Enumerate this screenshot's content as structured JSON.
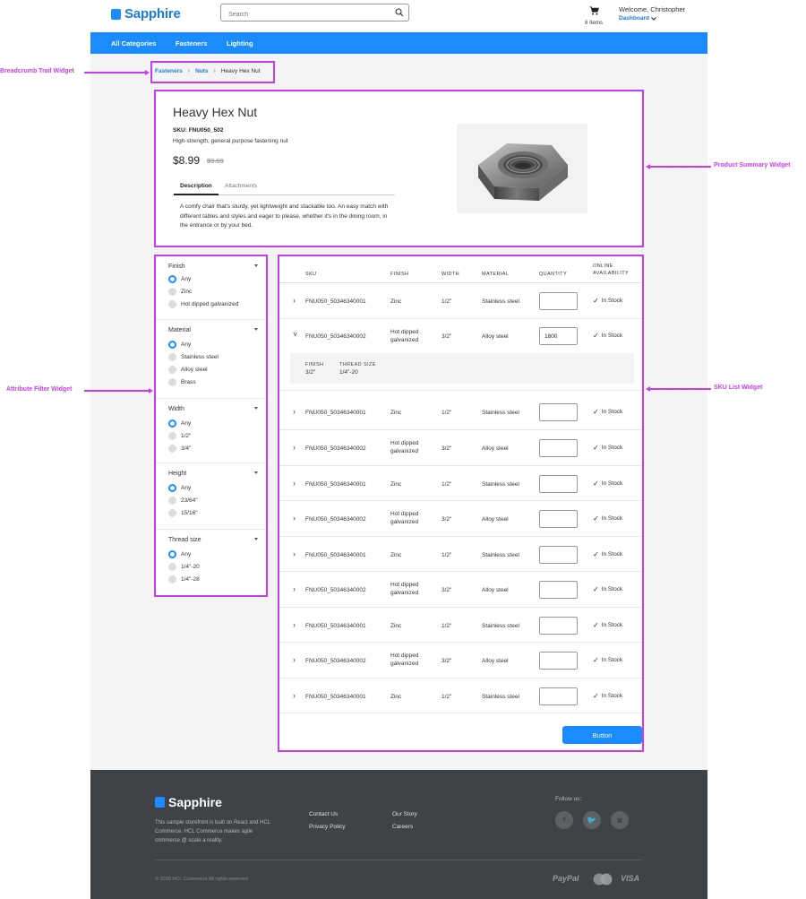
{
  "header": {
    "brand": "Sapphire",
    "search_placeholder": "Search",
    "cart_count": "6 Items",
    "welcome": "Welcome, Christopher",
    "dashboard": "Dashboard"
  },
  "nav": {
    "items": [
      "All Categories",
      "Fasteners",
      "Lighting"
    ]
  },
  "breadcrumb": {
    "items": [
      "Fasteners",
      "Nuts"
    ],
    "current": "Heavy Hex Nut"
  },
  "product": {
    "title": "Heavy Hex Nut",
    "sku": "SKU: FNU050_502",
    "short_desc": "High-strength, general purpose fastening nut",
    "price": "$8.99",
    "old_price": "$9.99",
    "tabs": [
      "Description",
      "Attachments"
    ],
    "description": "A comfy chair that's sturdy, yet lightweight and stackable too. An easy match with different tables and styles and eager to please, whether it's in the dining room, in the entrance or by your bed."
  },
  "filters": [
    {
      "title": "Finish",
      "options": [
        "Any",
        "Zinc",
        "Hot dipped galvanized"
      ]
    },
    {
      "title": "Material",
      "options": [
        "Any",
        "Stainless steel",
        "Alloy steel",
        "Brass"
      ]
    },
    {
      "title": "Width",
      "options": [
        "Any",
        "1/2\"",
        "3/4\""
      ]
    },
    {
      "title": "Height",
      "options": [
        "Any",
        "23/64\"",
        "15/16\""
      ]
    },
    {
      "title": "Thread size",
      "options": [
        "Any",
        "1/4\"-20",
        "1/4\"-28"
      ]
    }
  ],
  "sku_list": {
    "headers": {
      "sku": "SKU",
      "finish": "FINISH",
      "width": "WIDTH",
      "material": "MATERIAL",
      "quantity": "QUANTITY",
      "availability_1": "ONLINE",
      "availability_2": "AVAILABILITY"
    },
    "rows": [
      {
        "sku": "FNU050_50346340001",
        "finish": "Zinc",
        "width": "1/2\"",
        "material": "Stainless steel",
        "qty": "",
        "stock": "In Stock"
      },
      {
        "sku": "FNU050_50346340002",
        "finish": "Hot dipped galvanized",
        "width": "3/2\"",
        "material": "Alloy steel",
        "qty": "1800",
        "stock": "In Stock"
      },
      {
        "sku": "FNU050_50346340001",
        "finish": "Zinc",
        "width": "1/2\"",
        "material": "Stainless steel",
        "qty": "",
        "stock": "In Stock"
      },
      {
        "sku": "FNU050_50346340002",
        "finish": "Hot dipped galvanized",
        "width": "3/2\"",
        "material": "Alloy steel",
        "qty": "",
        "stock": "In Stock"
      },
      {
        "sku": "FNU050_50346340001",
        "finish": "Zinc",
        "width": "1/2\"",
        "material": "Stainless steel",
        "qty": "",
        "stock": "In Stock"
      },
      {
        "sku": "FNU050_50346340002",
        "finish": "Hot dipped galvanized",
        "width": "3/2\"",
        "material": "Alloy steel",
        "qty": "",
        "stock": "In Stock"
      },
      {
        "sku": "FNU050_50346340001",
        "finish": "Zinc",
        "width": "1/2\"",
        "material": "Stainless steel",
        "qty": "",
        "stock": "In Stock"
      },
      {
        "sku": "FNU050_50346340002",
        "finish": "Hot dipped galvanized",
        "width": "3/2\"",
        "material": "Alloy steel",
        "qty": "",
        "stock": "In Stock"
      },
      {
        "sku": "FNU050_50346340001",
        "finish": "Zinc",
        "width": "1/2\"",
        "material": "Stainless steel",
        "qty": "",
        "stock": "In Stock"
      },
      {
        "sku": "FNU050_50346340002",
        "finish": "Hot dipped galvanized",
        "width": "3/2\"",
        "material": "Alloy steel",
        "qty": "",
        "stock": "In Stock"
      },
      {
        "sku": "FNU050_50346340001",
        "finish": "Zinc",
        "width": "1/2\"",
        "material": "Stainless steel",
        "qty": "",
        "stock": "In Stock"
      }
    ],
    "expanded": {
      "finish_label": "FINISH",
      "finish_value": "3/2\"",
      "thread_label": "THREAD SIZE",
      "thread_value": "1/4\"-20"
    },
    "button": "Button"
  },
  "footer": {
    "brand": "Sapphire",
    "blurb": "This sample storefront is built on React and HCL Commerce. HCL Commerce makes agile commerce @ scale a reality.",
    "links": [
      "Contact Us",
      "Privacy Policy",
      "Our Story",
      "Careers"
    ],
    "follow": "Follow us:",
    "copyright": "© 2020 HCL Commerce All rights reserved",
    "payments": [
      "PayPal",
      "VISA"
    ]
  },
  "annotations": {
    "breadcrumb": "Breadcrumb Trail Widget",
    "product": "Product Summary Widget",
    "filter": "Attribute Filter Widget",
    "sku": "SKU List Widget"
  },
  "colors": {
    "brand": "#1a8cff",
    "annotation": "#c83cf0",
    "footer": "#3f4246"
  }
}
